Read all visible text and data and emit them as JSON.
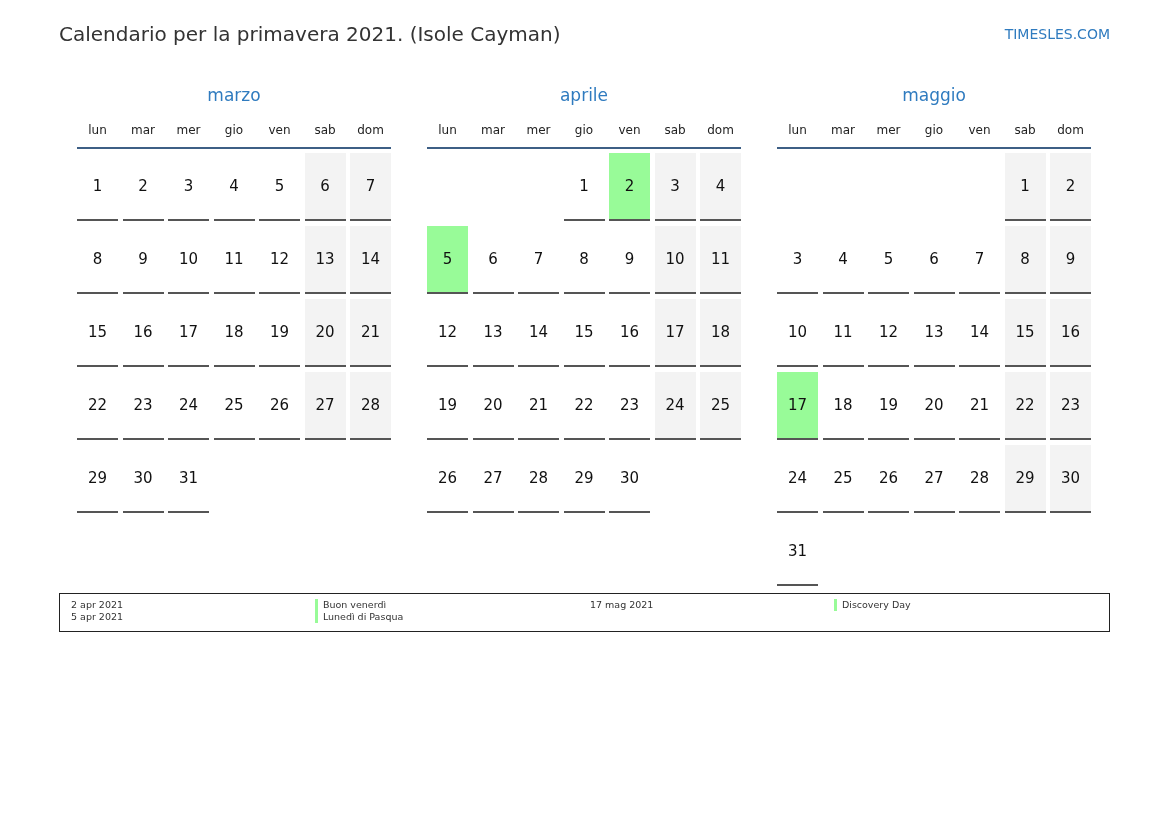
{
  "title": "Calendario per la primavera 2021. (Isole Cayman)",
  "site": "TIMESLES.COM",
  "months": [
    {
      "name": "marzo",
      "weekdays": [
        "lun",
        "mar",
        "mer",
        "gio",
        "ven",
        "sab",
        "dom"
      ],
      "weeks": [
        [
          {
            "kind": "day",
            "day": "1",
            "weekend": false,
            "holiday": false
          },
          {
            "kind": "day",
            "day": "2",
            "weekend": false,
            "holiday": false
          },
          {
            "kind": "day",
            "day": "3",
            "weekend": false,
            "holiday": false
          },
          {
            "kind": "day",
            "day": "4",
            "weekend": false,
            "holiday": false
          },
          {
            "kind": "day",
            "day": "5",
            "weekend": false,
            "holiday": false
          },
          {
            "kind": "day",
            "day": "6",
            "weekend": true,
            "holiday": false
          },
          {
            "kind": "day",
            "day": "7",
            "weekend": true,
            "holiday": false
          }
        ],
        [
          {
            "kind": "day",
            "day": "8",
            "weekend": false,
            "holiday": false
          },
          {
            "kind": "day",
            "day": "9",
            "weekend": false,
            "holiday": false
          },
          {
            "kind": "day",
            "day": "10",
            "weekend": false,
            "holiday": false
          },
          {
            "kind": "day",
            "day": "11",
            "weekend": false,
            "holiday": false
          },
          {
            "kind": "day",
            "day": "12",
            "weekend": false,
            "holiday": false
          },
          {
            "kind": "day",
            "day": "13",
            "weekend": true,
            "holiday": false
          },
          {
            "kind": "day",
            "day": "14",
            "weekend": true,
            "holiday": false
          }
        ],
        [
          {
            "kind": "day",
            "day": "15",
            "weekend": false,
            "holiday": false
          },
          {
            "kind": "day",
            "day": "16",
            "weekend": false,
            "holiday": false
          },
          {
            "kind": "day",
            "day": "17",
            "weekend": false,
            "holiday": false
          },
          {
            "kind": "day",
            "day": "18",
            "weekend": false,
            "holiday": false
          },
          {
            "kind": "day",
            "day": "19",
            "weekend": false,
            "holiday": false
          },
          {
            "kind": "day",
            "day": "20",
            "weekend": true,
            "holiday": false
          },
          {
            "kind": "day",
            "day": "21",
            "weekend": true,
            "holiday": false
          }
        ],
        [
          {
            "kind": "day",
            "day": "22",
            "weekend": false,
            "holiday": false
          },
          {
            "kind": "day",
            "day": "23",
            "weekend": false,
            "holiday": false
          },
          {
            "kind": "day",
            "day": "24",
            "weekend": false,
            "holiday": false
          },
          {
            "kind": "day",
            "day": "25",
            "weekend": false,
            "holiday": false
          },
          {
            "kind": "day",
            "day": "26",
            "weekend": false,
            "holiday": false
          },
          {
            "kind": "day",
            "day": "27",
            "weekend": true,
            "holiday": false
          },
          {
            "kind": "day",
            "day": "28",
            "weekend": true,
            "holiday": false
          }
        ],
        [
          {
            "kind": "day",
            "day": "29",
            "weekend": false,
            "holiday": false
          },
          {
            "kind": "day",
            "day": "30",
            "weekend": false,
            "holiday": false
          },
          {
            "kind": "day",
            "day": "31",
            "weekend": false,
            "holiday": false
          }
        ]
      ]
    },
    {
      "name": "aprile",
      "weekdays": [
        "lun",
        "mar",
        "mer",
        "gio",
        "ven",
        "sab",
        "dom"
      ],
      "weeks": [
        [
          {
            "kind": "empty"
          },
          {
            "kind": "empty"
          },
          {
            "kind": "empty"
          },
          {
            "kind": "day",
            "day": "1",
            "weekend": false,
            "holiday": false
          },
          {
            "kind": "day",
            "day": "2",
            "holiday": true
          },
          {
            "kind": "day",
            "day": "3",
            "weekend": true,
            "holiday": false
          },
          {
            "kind": "day",
            "day": "4",
            "weekend": true,
            "holiday": false
          }
        ],
        [
          {
            "kind": "day",
            "day": "5",
            "holiday": true
          },
          {
            "kind": "day",
            "day": "6",
            "weekend": false,
            "holiday": false
          },
          {
            "kind": "day",
            "day": "7",
            "weekend": false,
            "holiday": false
          },
          {
            "kind": "day",
            "day": "8",
            "weekend": false,
            "holiday": false
          },
          {
            "kind": "day",
            "day": "9",
            "weekend": false,
            "holiday": false
          },
          {
            "kind": "day",
            "day": "10",
            "weekend": true,
            "holiday": false
          },
          {
            "kind": "day",
            "day": "11",
            "weekend": true,
            "holiday": false
          }
        ],
        [
          {
            "kind": "day",
            "day": "12",
            "weekend": false,
            "holiday": false
          },
          {
            "kind": "day",
            "day": "13",
            "weekend": false,
            "holiday": false
          },
          {
            "kind": "day",
            "day": "14",
            "weekend": false,
            "holiday": false
          },
          {
            "kind": "day",
            "day": "15",
            "weekend": false,
            "holiday": false
          },
          {
            "kind": "day",
            "day": "16",
            "weekend": false,
            "holiday": false
          },
          {
            "kind": "day",
            "day": "17",
            "weekend": true,
            "holiday": false
          },
          {
            "kind": "day",
            "day": "18",
            "weekend": true,
            "holiday": false
          }
        ],
        [
          {
            "kind": "day",
            "day": "19",
            "weekend": false,
            "holiday": false
          },
          {
            "kind": "day",
            "day": "20",
            "weekend": false,
            "holiday": false
          },
          {
            "kind": "day",
            "day": "21",
            "weekend": false,
            "holiday": false
          },
          {
            "kind": "day",
            "day": "22",
            "weekend": false,
            "holiday": false
          },
          {
            "kind": "day",
            "day": "23",
            "weekend": false,
            "holiday": false
          },
          {
            "kind": "day",
            "day": "24",
            "weekend": true,
            "holiday": false
          },
          {
            "kind": "day",
            "day": "25",
            "weekend": true,
            "holiday": false
          }
        ],
        [
          {
            "kind": "day",
            "day": "26",
            "weekend": false,
            "holiday": false
          },
          {
            "kind": "day",
            "day": "27",
            "weekend": false,
            "holiday": false
          },
          {
            "kind": "day",
            "day": "28",
            "weekend": false,
            "holiday": false
          },
          {
            "kind": "day",
            "day": "29",
            "weekend": false,
            "holiday": false
          },
          {
            "kind": "day",
            "day": "30",
            "weekend": false,
            "holiday": false
          }
        ]
      ]
    },
    {
      "name": "maggio",
      "weekdays": [
        "lun",
        "mar",
        "mer",
        "gio",
        "ven",
        "sab",
        "dom"
      ],
      "weeks": [
        [
          {
            "kind": "empty"
          },
          {
            "kind": "empty"
          },
          {
            "kind": "empty"
          },
          {
            "kind": "empty"
          },
          {
            "kind": "empty"
          },
          {
            "kind": "day",
            "day": "1",
            "weekend": true,
            "holiday": false
          },
          {
            "kind": "day",
            "day": "2",
            "weekend": true,
            "holiday": false
          }
        ],
        [
          {
            "kind": "day",
            "day": "3",
            "weekend": false,
            "holiday": false
          },
          {
            "kind": "day",
            "day": "4",
            "weekend": false,
            "holiday": false
          },
          {
            "kind": "day",
            "day": "5",
            "weekend": false,
            "holiday": false
          },
          {
            "kind": "day",
            "day": "6",
            "weekend": false,
            "holiday": false
          },
          {
            "kind": "day",
            "day": "7",
            "weekend": false,
            "holiday": false
          },
          {
            "kind": "day",
            "day": "8",
            "weekend": true,
            "holiday": false
          },
          {
            "kind": "day",
            "day": "9",
            "weekend": true,
            "holiday": false
          }
        ],
        [
          {
            "kind": "day",
            "day": "10",
            "weekend": false,
            "holiday": false
          },
          {
            "kind": "day",
            "day": "11",
            "weekend": false,
            "holiday": false
          },
          {
            "kind": "day",
            "day": "12",
            "weekend": false,
            "holiday": false
          },
          {
            "kind": "day",
            "day": "13",
            "weekend": false,
            "holiday": false
          },
          {
            "kind": "day",
            "day": "14",
            "weekend": false,
            "holiday": false
          },
          {
            "kind": "day",
            "day": "15",
            "weekend": true,
            "holiday": false
          },
          {
            "kind": "day",
            "day": "16",
            "weekend": true,
            "holiday": false
          }
        ],
        [
          {
            "kind": "day",
            "day": "17",
            "holiday": true
          },
          {
            "kind": "day",
            "day": "18",
            "weekend": false,
            "holiday": false
          },
          {
            "kind": "day",
            "day": "19",
            "weekend": false,
            "holiday": false
          },
          {
            "kind": "day",
            "day": "20",
            "weekend": false,
            "holiday": false
          },
          {
            "kind": "day",
            "day": "21",
            "weekend": false,
            "holiday": false
          },
          {
            "kind": "day",
            "day": "22",
            "weekend": true,
            "holiday": false
          },
          {
            "kind": "day",
            "day": "23",
            "weekend": true,
            "holiday": false
          }
        ],
        [
          {
            "kind": "day",
            "day": "24",
            "weekend": false,
            "holiday": false
          },
          {
            "kind": "day",
            "day": "25",
            "weekend": false,
            "holiday": false
          },
          {
            "kind": "day",
            "day": "26",
            "weekend": false,
            "holiday": false
          },
          {
            "kind": "day",
            "day": "27",
            "weekend": false,
            "holiday": false
          },
          {
            "kind": "day",
            "day": "28",
            "weekend": false,
            "holiday": false
          },
          {
            "kind": "day",
            "day": "29",
            "weekend": true,
            "holiday": false
          },
          {
            "kind": "day",
            "day": "30",
            "weekend": true,
            "holiday": false
          }
        ],
        [
          {
            "kind": "day",
            "day": "31",
            "weekend": false,
            "holiday": false
          }
        ]
      ]
    }
  ],
  "legend": [
    {
      "items": [
        {
          "date": "2 apr 2021",
          "name": "Buon venerdì"
        },
        {
          "date": "5 apr 2021",
          "name": "Lunedì di Pasqua"
        }
      ]
    },
    {
      "items": [
        {
          "date": "17 mag 2021",
          "name": "Discovery Day"
        }
      ]
    }
  ]
}
